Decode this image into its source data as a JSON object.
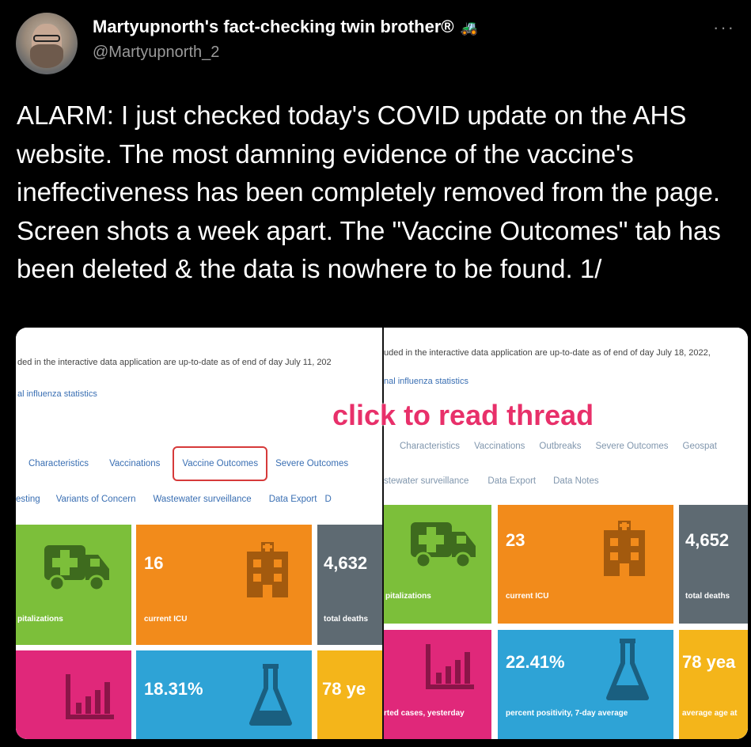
{
  "tweet": {
    "author_name": "Martyupnorth's fact-checking twin brother®",
    "author_badge": "tractor-emoji",
    "handle": "@Martyupnorth_2",
    "more_label": "···",
    "text": "ALARM: I just checked today's COVID update on the AHS website. The most damning evidence of the vaccine's ineffectiveness has been completely removed from the page. Screen shots a week apart. The \"Vaccine Outcomes\" tab has been deleted & the data is nowhere to be found. 1/"
  },
  "overlay_text": "click to read thread",
  "left_screenshot": {
    "date_text": "ded in the interactive data application are up-to-date as of end of day July 11, 202",
    "influenza_link": "al influenza statistics",
    "tabs_row1": [
      "Characteristics",
      "Vaccinations",
      "Vaccine Outcomes",
      "Severe Outcomes"
    ],
    "tabs_row2": [
      "esting",
      "Variants of Concern",
      "Wastewater surveillance",
      "Data Export",
      "D"
    ],
    "tiles": {
      "hosp_label": "pitalizations",
      "icu_value": "16",
      "icu_label": "current ICU",
      "deaths_value": "4,632",
      "deaths_label": "total deaths",
      "positivity_value": "18.31%",
      "age_value": "78 ye"
    }
  },
  "right_screenshot": {
    "date_text": "uded in the interactive data application are up-to-date as of end of day July 18, 2022, ",
    "influenza_link": "nal influenza statistics",
    "tabs_row1": [
      "Characteristics",
      "Vaccinations",
      "Outbreaks",
      "Severe Outcomes",
      "Geospat"
    ],
    "tabs_row2": [
      "stewater surveillance",
      "Data Export",
      "Data Notes"
    ],
    "tiles": {
      "hosp_label": "pitalizations",
      "icu_value": "23",
      "icu_label": "current ICU",
      "deaths_value": "4,652",
      "deaths_label": "total deaths",
      "cases_label": "rted cases, yesterday",
      "positivity_value": "22.41%",
      "positivity_label": "percent positivity, 7-day average",
      "age_value": "78 yea",
      "age_label": "average age at"
    }
  },
  "colors": {
    "highlight_box": "#d63a3a",
    "overlay_text": "#e8306a",
    "tile_green": "#7cbf3a",
    "tile_orange": "#f28b1b",
    "tile_gray": "#5e6a72",
    "tile_magenta": "#e0287a",
    "tile_blue": "#2ea3d6",
    "tile_yellow": "#f4b51a"
  }
}
